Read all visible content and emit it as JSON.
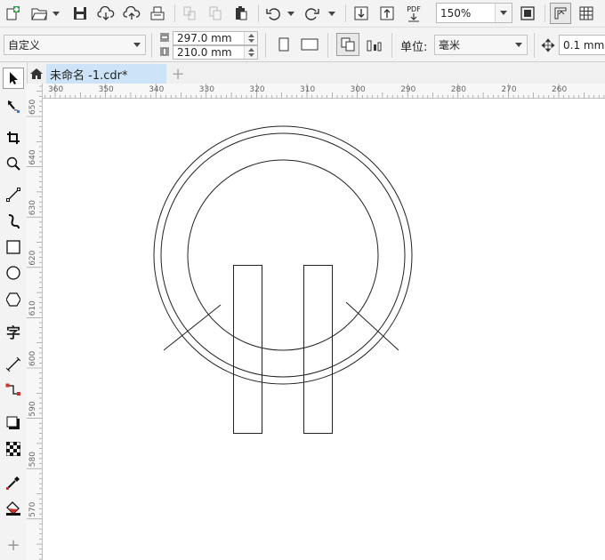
{
  "toolbar": {
    "zoom_value": "150%",
    "pdf_label": "PDF"
  },
  "property_bar": {
    "paper_preset": "自定义",
    "width_value": "297.0 mm",
    "height_value": "210.0 mm",
    "units_label": "单位:",
    "units_value": "毫米",
    "nudge_value": "0.1 mm"
  },
  "document_tab": {
    "title": "未命名 -1.cdr*",
    "add_label": "+"
  },
  "toolbox": {
    "text_tool_label": "字",
    "add_label": "+"
  },
  "ruler_h": {
    "labels": [
      "360",
      "350",
      "340",
      "330",
      "320",
      "310",
      "300",
      "290",
      "280",
      "270",
      "260"
    ]
  },
  "ruler_v": {
    "labels": [
      "650",
      "640",
      "630",
      "620",
      "610",
      "600",
      "590",
      "580",
      "570"
    ]
  },
  "drawing": {
    "shapes": [
      "outer-circle",
      "middle-circle",
      "inner-circle",
      "left-rectangle",
      "right-rectangle",
      "left-diagonal-line",
      "right-diagonal-line"
    ]
  },
  "colors": {
    "tab_active": "#cde3f7",
    "stroke": "#222222",
    "accent_red": "#d0302a",
    "accent_green": "#2ea043"
  }
}
